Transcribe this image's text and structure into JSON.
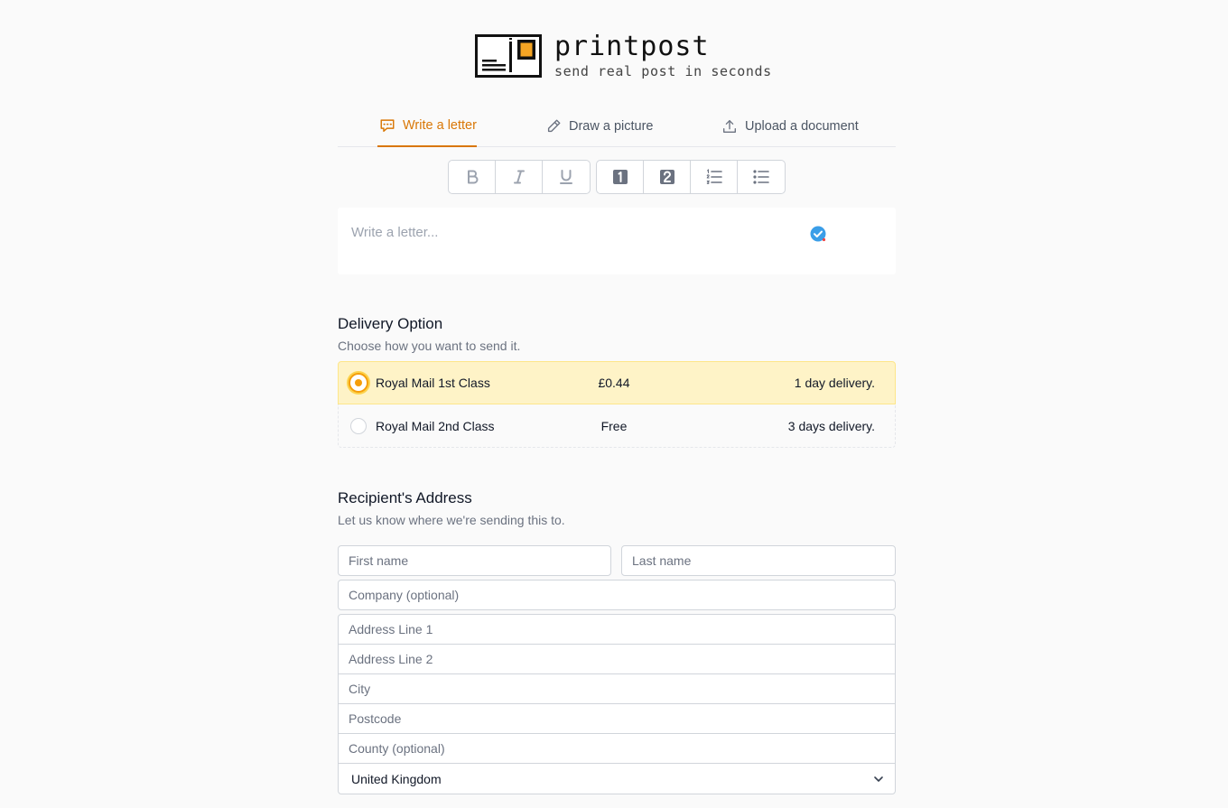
{
  "brand": {
    "name": "printpost",
    "tagline": "send real post in seconds"
  },
  "tabs": [
    {
      "label": "Write a letter",
      "icon": "chat-bubble-icon",
      "active": true
    },
    {
      "label": "Draw a picture",
      "icon": "pencil-icon",
      "active": false
    },
    {
      "label": "Upload a document",
      "icon": "upload-icon",
      "active": false
    }
  ],
  "toolbar": {
    "buttons": [
      "bold-icon",
      "italic-icon",
      "underline-icon",
      "heading-1-icon",
      "heading-2-icon",
      "numbered-list-icon",
      "bullet-list-icon"
    ]
  },
  "editor": {
    "placeholder": "Write a letter..."
  },
  "delivery": {
    "title": "Delivery Option",
    "subtitle": "Choose how you want to send it.",
    "options": [
      {
        "name": "Royal Mail 1st Class",
        "price": "£0.44",
        "time": "1 day delivery.",
        "selected": true
      },
      {
        "name": "Royal Mail 2nd Class",
        "price": "Free",
        "time": "3 days delivery.",
        "selected": false
      }
    ]
  },
  "address": {
    "title": "Recipient's Address",
    "subtitle": "Let us know where we're sending this to.",
    "placeholders": {
      "first_name": "First name",
      "last_name": "Last name",
      "company": "Company (optional)",
      "line1": "Address Line 1",
      "line2": "Address Line 2",
      "city": "City",
      "postcode": "Postcode",
      "county": "County (optional)"
    },
    "country": "United Kingdom"
  },
  "colors": {
    "accent": "#d97706",
    "selected_bg": "#fef3c7",
    "check": "#3b9ee8"
  }
}
